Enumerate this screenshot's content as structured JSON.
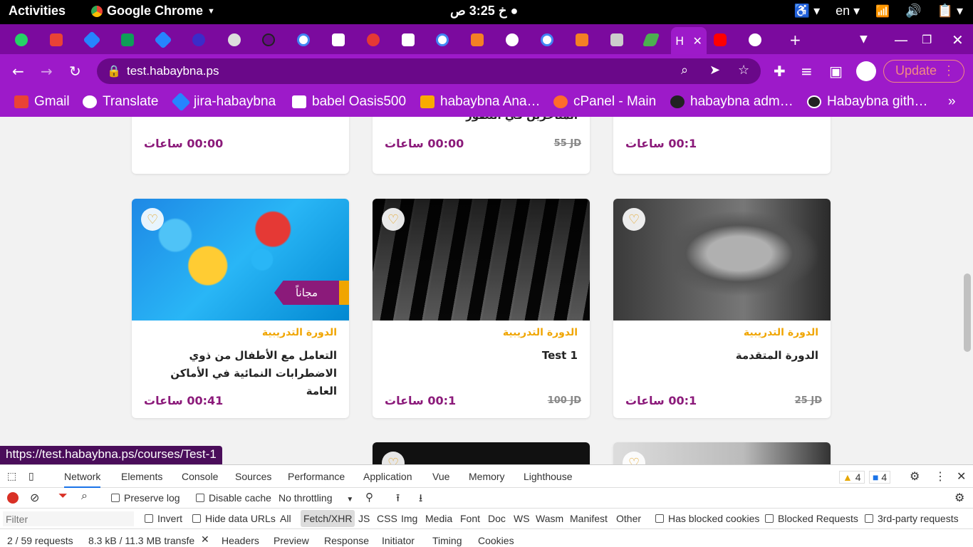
{
  "system": {
    "activities": "Activities",
    "app_name": "Google Chrome",
    "clock": "3:25 ص",
    "clock_day": "خ",
    "language": "en"
  },
  "browser": {
    "url": "test.habaybna.ps",
    "update_label": "Update",
    "active_tab_label": "H",
    "bookmarks": [
      {
        "label": "Gmail",
        "color": "#ea4335"
      },
      {
        "label": "Translate",
        "color": "#ffffff"
      },
      {
        "label": "jira-habaybna",
        "color": "#2684ff"
      },
      {
        "label": "babel Oasis500",
        "color": "#ffffff"
      },
      {
        "label": "habaybna Ana…",
        "color": "#f9ab00"
      },
      {
        "label": "cPanel - Main",
        "color": "#ff6c2c"
      },
      {
        "label": "habaybna adm…",
        "color": "#222222"
      },
      {
        "label": "Habaybna gith…",
        "color": "#222222"
      }
    ]
  },
  "page": {
    "top_row": [
      {
        "hours": "00:00 ساعات",
        "title_fragment": ""
      },
      {
        "hours": "00:00 ساعات",
        "title_fragment": "المتأخرين في التطور",
        "price": "55 JD"
      },
      {
        "hours": "00:1 ساعات",
        "title_fragment": ""
      }
    ],
    "cards": [
      {
        "category": "الدورة التدريبية",
        "title": "التعامل مع الأطفال من ذوي الاضطرابات النمائية في الأماكن العامة",
        "hours": "00:41 ساعات",
        "badge": "مجاناً"
      },
      {
        "category": "الدورة التدريبية",
        "title": "Test 1",
        "hours": "00:1 ساعات",
        "price": "100 JD"
      },
      {
        "category": "الدورة التدريبية",
        "title": "الدورة المتقدمة",
        "hours": "00:1 ساعات",
        "price": "25 JD"
      }
    ],
    "status_url": "https://test.habaybna.ps/courses/Test-1"
  },
  "devtools": {
    "tabs": [
      "Network",
      "Elements",
      "Console",
      "Sources",
      "Performance",
      "Application",
      "Vue",
      "Memory",
      "Lighthouse"
    ],
    "warnings": "4",
    "messages": "4",
    "preserve_log": "Preserve log",
    "disable_cache": "Disable cache",
    "throttling": "No throttling",
    "filter_placeholder": "Filter",
    "invert": "Invert",
    "hide_data_urls": "Hide data URLs",
    "types": [
      "All",
      "Fetch/XHR",
      "JS",
      "CSS",
      "Img",
      "Media",
      "Font",
      "Doc",
      "WS",
      "Wasm",
      "Manifest",
      "Other"
    ],
    "has_blocked_cookies": "Has blocked cookies",
    "blocked_requests": "Blocked Requests",
    "third_party": "3rd-party requests",
    "request_count": "2 / 59 requests",
    "transfer": "8.3 kB / 11.3 MB transfe",
    "detail_tabs": [
      "Headers",
      "Preview",
      "Response",
      "Initiator",
      "Timing",
      "Cookies"
    ]
  }
}
